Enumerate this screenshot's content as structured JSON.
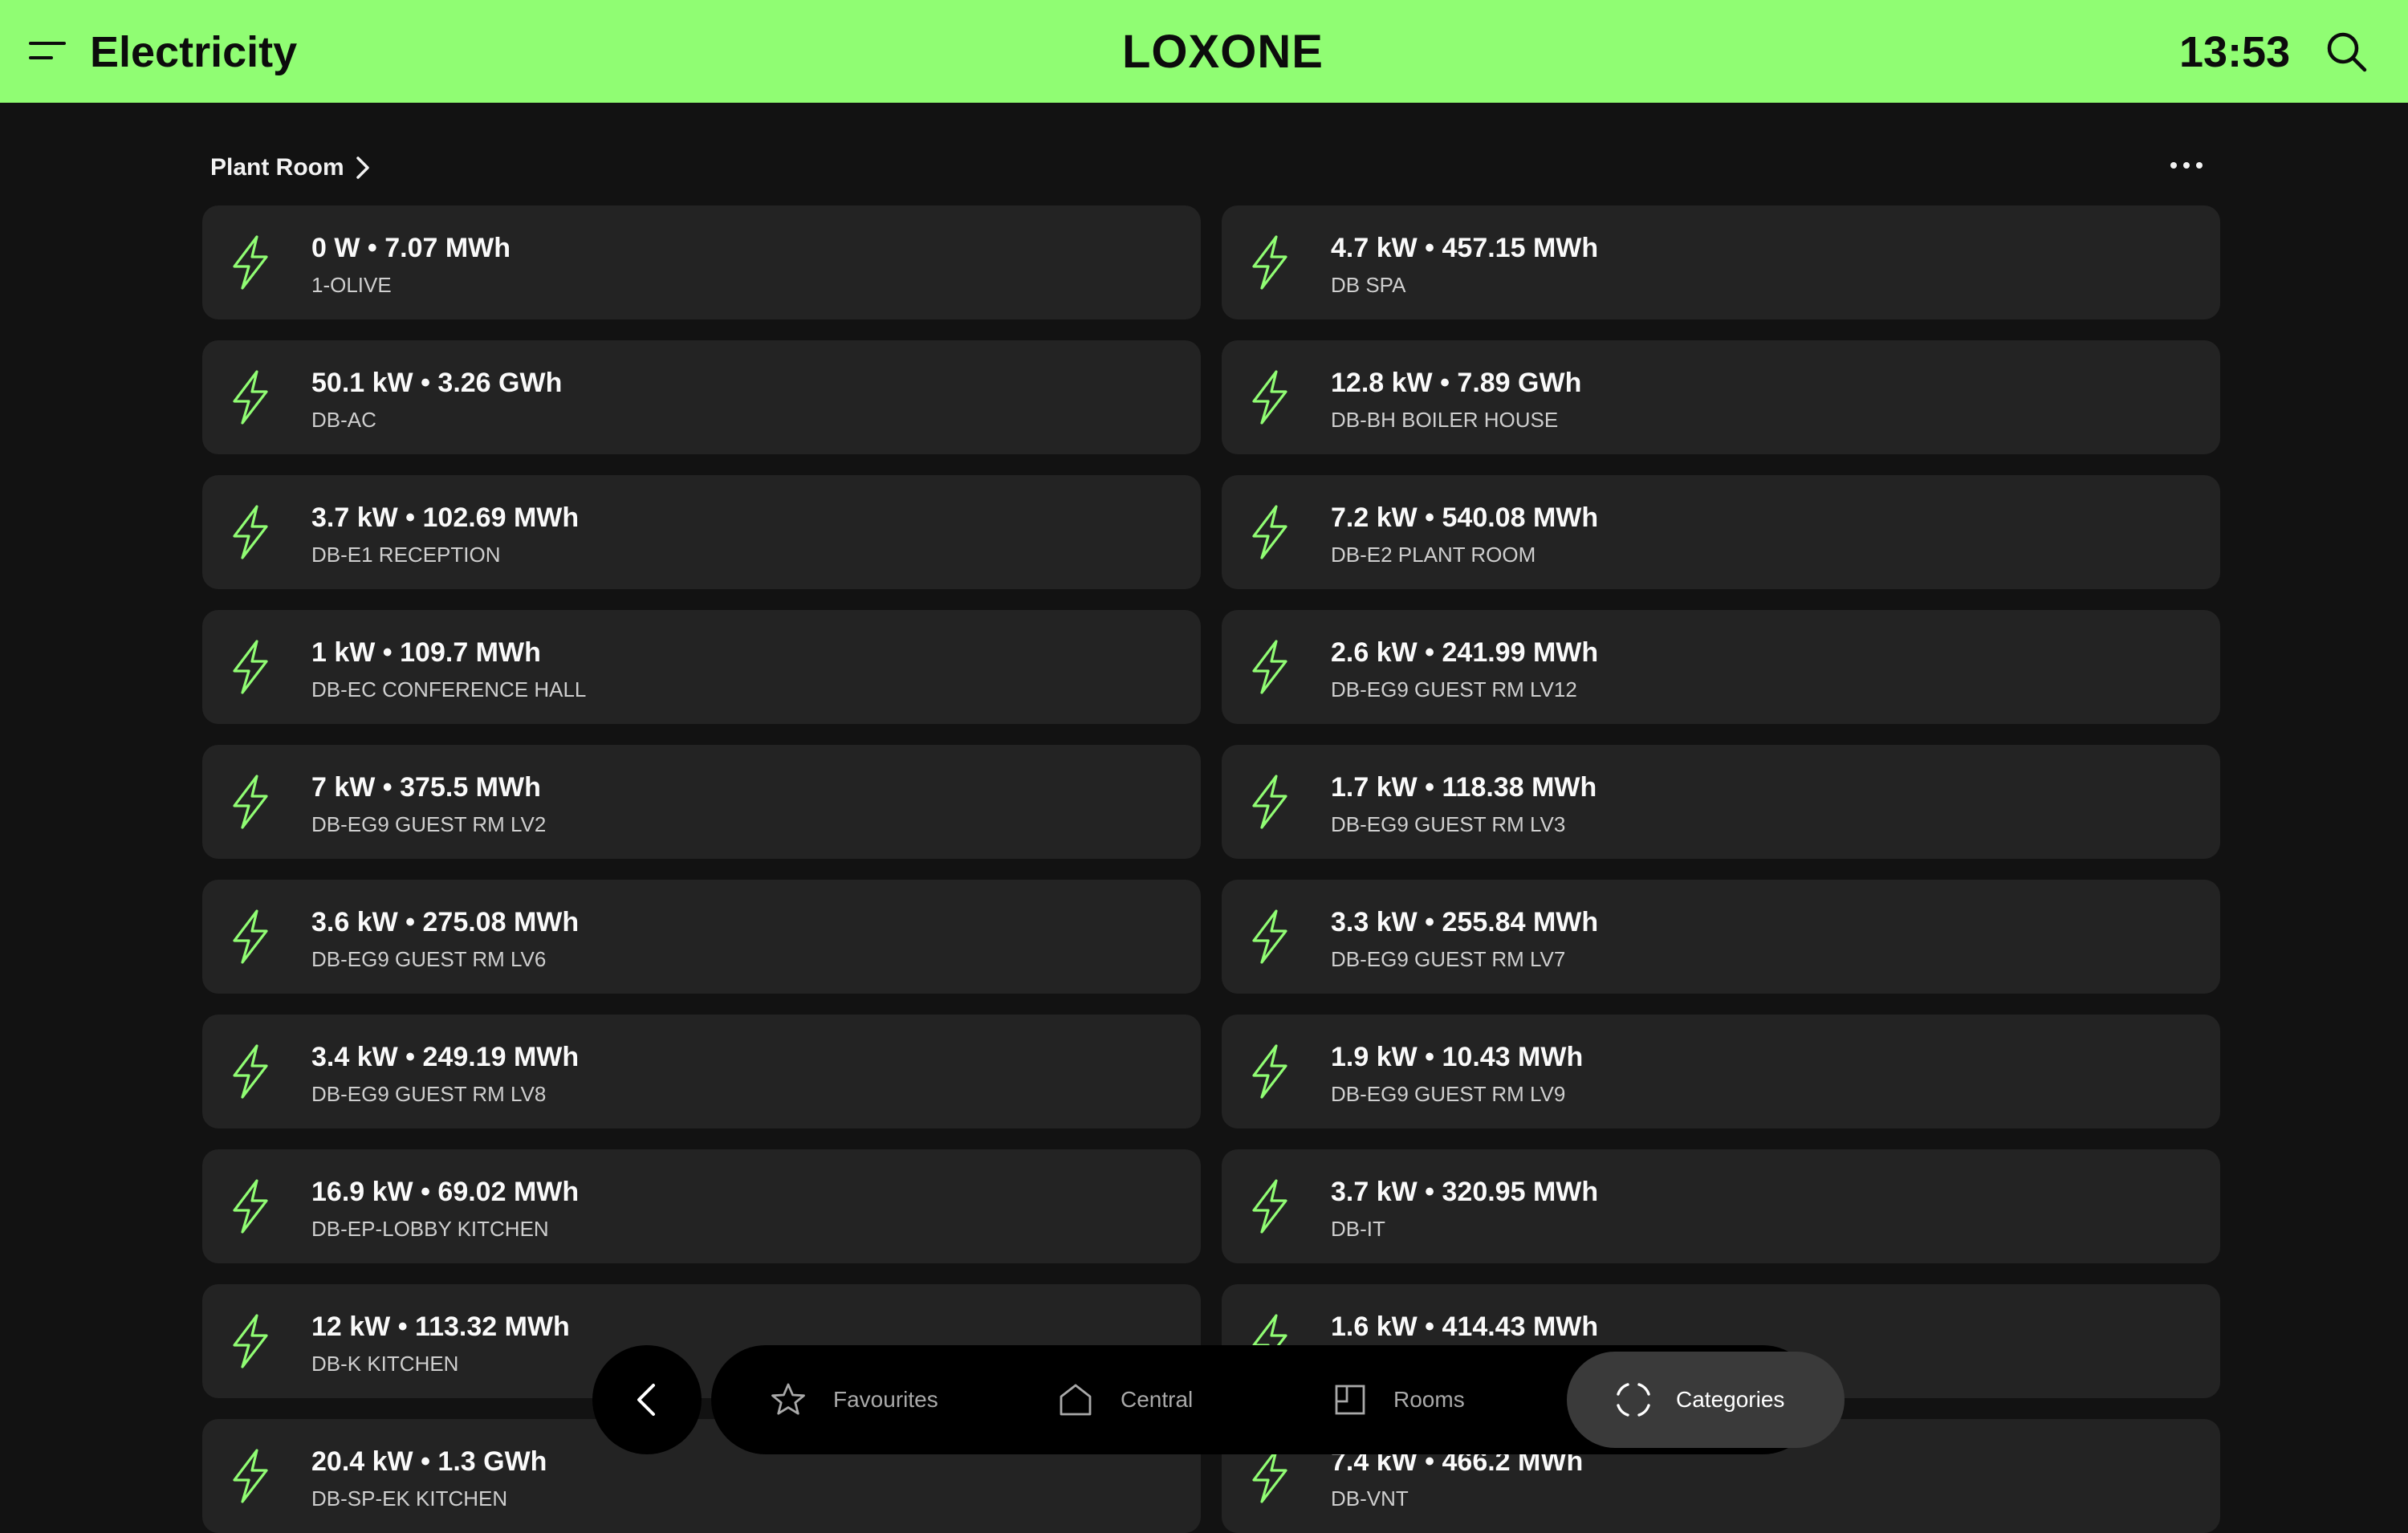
{
  "header": {
    "title": "Electricity",
    "logo": "LOXONE",
    "time": "13:53",
    "icons": {
      "menu": "menu-icon",
      "search": "search-icon"
    }
  },
  "section": {
    "room": "Plant Room",
    "more_icon": "more-dots-icon"
  },
  "meters": [
    {
      "value": "0 W • 7.07 MWh",
      "name": "1-OLIVE"
    },
    {
      "value": "4.7 kW • 457.15 MWh",
      "name": "DB SPA"
    },
    {
      "value": "50.1 kW • 3.26 GWh",
      "name": "DB-AC"
    },
    {
      "value": "12.8 kW • 7.89 GWh",
      "name": "DB-BH BOILER HOUSE"
    },
    {
      "value": "3.7 kW • 102.69 MWh",
      "name": "DB-E1 RECEPTION"
    },
    {
      "value": "7.2 kW • 540.08 MWh",
      "name": "DB-E2 PLANT ROOM"
    },
    {
      "value": "1 kW • 109.7 MWh",
      "name": "DB-EC CONFERENCE HALL"
    },
    {
      "value": "2.6 kW • 241.99 MWh",
      "name": "DB-EG9 GUEST RM LV12"
    },
    {
      "value": "7 kW • 375.5 MWh",
      "name": "DB-EG9 GUEST RM LV2"
    },
    {
      "value": "1.7 kW • 118.38 MWh",
      "name": "DB-EG9 GUEST RM LV3"
    },
    {
      "value": "3.6 kW • 275.08 MWh",
      "name": "DB-EG9 GUEST RM LV6"
    },
    {
      "value": "3.3 kW • 255.84 MWh",
      "name": "DB-EG9 GUEST RM LV7"
    },
    {
      "value": "3.4 kW • 249.19 MWh",
      "name": "DB-EG9 GUEST RM LV8"
    },
    {
      "value": "1.9 kW • 10.43 MWh",
      "name": "DB-EG9 GUEST RM LV9"
    },
    {
      "value": "16.9 kW • 69.02 MWh",
      "name": "DB-EP-LOBBY KITCHEN"
    },
    {
      "value": "3.7 kW • 320.95 MWh",
      "name": "DB-IT"
    },
    {
      "value": "12 kW • 113.32 MWh",
      "name": "DB-K KITCHEN"
    },
    {
      "value": "1.6 kW • 414.43 MWh",
      "name": ""
    },
    {
      "value": "20.4 kW • 1.3 GWh",
      "name": "DB-SP-EK KITCHEN"
    },
    {
      "value": "7.4 kW • 466.2 MWh",
      "name": "DB-VNT"
    }
  ],
  "nav": {
    "back_icon": "chevron-left-icon",
    "tabs": [
      {
        "label": "Favourites",
        "icon": "star-icon"
      },
      {
        "label": "Central",
        "icon": "home-icon"
      },
      {
        "label": "Rooms",
        "icon": "room-icon"
      },
      {
        "label": "Categories",
        "icon": "categories-icon",
        "active": true
      }
    ]
  },
  "colors": {
    "accent": "#90fd73",
    "background": "#121212",
    "tile": "#232323",
    "bolt": "#90fd73"
  }
}
